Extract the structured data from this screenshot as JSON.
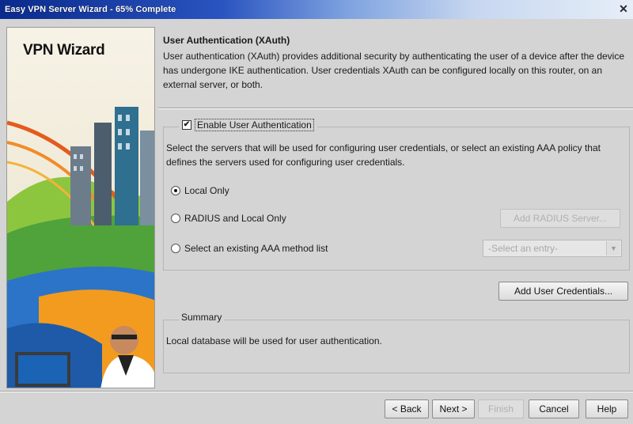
{
  "window": {
    "title": "Easy VPN Server Wizard - 65% Complete",
    "progress_percent": 65
  },
  "left_panel": {
    "logo_text": "VPN Wizard"
  },
  "header": {
    "title": "User Authentication (XAuth)",
    "description": "User authentication (XAuth) provides additional security by authenticating the user of a device after the device has undergone IKE authentication. User credentials XAuth can be configured locally on this router, on an external server, or both."
  },
  "auth": {
    "enable_label": "Enable User Authentication",
    "enabled": true,
    "description": "Select the servers that will be used for configuring user credentials, or select an existing AAA policy that defines the servers used for configuring user credentials.",
    "options": [
      {
        "label": "Local Only",
        "selected": true
      },
      {
        "label": "RADIUS and Local Only",
        "selected": false
      },
      {
        "label": "Select an existing AAA method list",
        "selected": false
      }
    ],
    "add_radius_label": "Add RADIUS Server...",
    "method_list_placeholder": "-Select an entry-",
    "add_credentials_label": "Add User Credentials..."
  },
  "summary": {
    "legend": "Summary",
    "text": "Local database will be used for user authentication."
  },
  "footer": {
    "back": "< Back",
    "next": "Next >",
    "finish": "Finish",
    "cancel": "Cancel",
    "help": "Help"
  },
  "colors": {
    "titlebar_start": "#0a2a8c",
    "window_bg": "#d4d4d4"
  },
  "icons": {
    "close": "close-icon",
    "checkbox": "checkbox-checked",
    "dropdown": "chevron-down-icon"
  }
}
